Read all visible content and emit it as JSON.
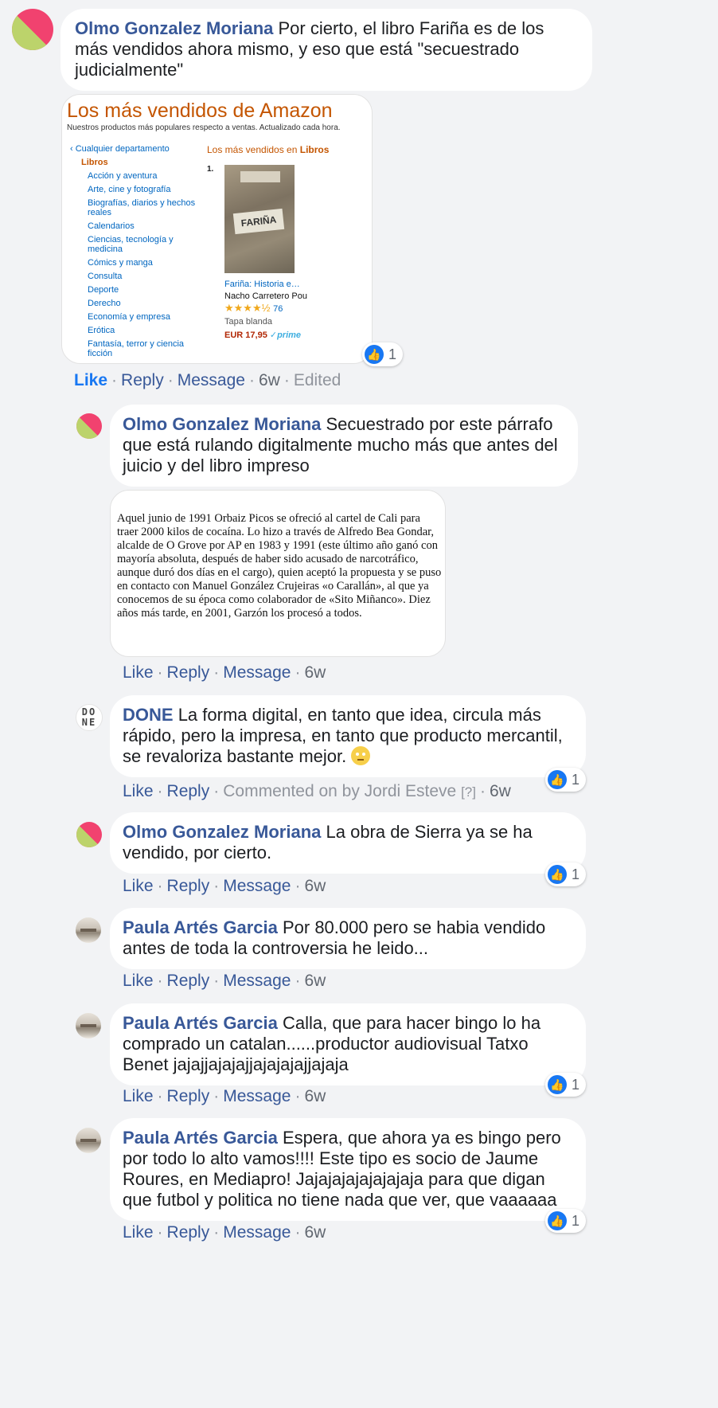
{
  "comments": [
    {
      "author": "Olmo Gonzalez Moriana",
      "text": "Por cierto, el libro Fariña es de los más vendidos ahora mismo, y eso que está \"secuestrado judicialmente\"",
      "reactions": "1",
      "actions": {
        "like": "Like",
        "reply": "Reply",
        "message": "Message",
        "time": "6w",
        "edited": "Edited"
      }
    },
    {
      "author": "Olmo Gonzalez Moriana",
      "text": "Secuestrado por este párrafo que está rulando digitalmente mucho más que antes del juicio y del libro impreso",
      "actions": {
        "like": "Like",
        "reply": "Reply",
        "message": "Message",
        "time": "6w"
      }
    },
    {
      "author": "DONE",
      "text": "La forma digital, en tanto que idea, circula más rápido, pero la impresa, en tanto que producto mercantil, se revaloriza bastante mejor.",
      "reactions": "1",
      "actions": {
        "like": "Like",
        "reply": "Reply",
        "commented_on": "Commented on by Jordi Esteve",
        "help": "[?]",
        "time": "6w"
      }
    },
    {
      "author": "Olmo Gonzalez Moriana",
      "text": "La obra de Sierra ya se ha vendido, por cierto.",
      "reactions": "1",
      "actions": {
        "like": "Like",
        "reply": "Reply",
        "message": "Message",
        "time": "6w"
      }
    },
    {
      "author": "Paula Artés Garcia",
      "text": "Por 80.000 pero se habia vendido antes de toda la controversia he leido...",
      "actions": {
        "like": "Like",
        "reply": "Reply",
        "message": "Message",
        "time": "6w"
      }
    },
    {
      "author": "Paula Artés Garcia",
      "text": "Calla, que para hacer bingo lo ha comprado un catalan......productor audiovisual Tatxo Benet jajajjajajajjajajajajjajaja",
      "reactions": "1",
      "actions": {
        "like": "Like",
        "reply": "Reply",
        "message": "Message",
        "time": "6w"
      }
    },
    {
      "author": "Paula Artés Garcia",
      "text": "Espera, que ahora ya es bingo pero por todo lo alto vamos!!!! Este tipo es socio de Jaume Roures, en Mediapro! Jajajajajajajajaja para que digan que futbol y politica no tiene nada que ver, que vaaaaaa",
      "reactions": "1",
      "actions": {
        "like": "Like",
        "reply": "Reply",
        "message": "Message",
        "time": "6w"
      }
    }
  ],
  "done_avatar": {
    "line1": "DO",
    "line2": "NE"
  },
  "amazon": {
    "title": "Los más vendidos de Amazon",
    "subtitle": "Nuestros productos más populares respecto a ventas. Actualizado cada hora.",
    "any_department": "‹ Cualquier departamento",
    "current": "Libros",
    "categories": [
      "Acción y aventura",
      "Arte, cine y fotografía",
      "Biografías, diarios y hechos reales",
      "Calendarios",
      "Ciencias, tecnología y medicina",
      "Cómics y manga",
      "Consulta",
      "Deporte",
      "Derecho",
      "Economía y empresa",
      "Erótica",
      "Fantasía, terror y ciencia ficción"
    ],
    "bestsellers_prefix": "Los más vendidos en ",
    "bestsellers_cat": "Libros",
    "rank": "1.",
    "cover_text": "FARIÑA",
    "product_title": "Fariña: Historia e…",
    "product_author": "Nacho Carretero Pou",
    "stars": "★★★★½",
    "rating_count": "76",
    "format": "Tapa blanda",
    "price": "EUR 17,95",
    "prime": "✓prime"
  },
  "quote_text": "Aquel junio de 1991 Orbaiz Picos se ofreció al cartel de Cali para traer 2000 kilos de cocaína. Lo hizo a través de Alfredo Bea Gondar, alcalde de O Grove por AP en 1983 y 1991 (este último año ganó con mayoría absoluta, después de haber sido acusado de narcotráfico, aunque duró dos días en el cargo), quien aceptó la propuesta y se puso en contacto con Manuel González Crujeiras «o Carallán», al que ya conocemos de su época como colaborador de «Sito Miñanco». Diez años más tarde, en 2001, Garzón los procesó a todos.",
  "colors": {
    "link": "#385898",
    "like_blue": "#1877f2",
    "background": "#f2f3f5"
  },
  "icons": {
    "like": "like-thumb-icon",
    "emoji": "eye-roll-emoji"
  }
}
